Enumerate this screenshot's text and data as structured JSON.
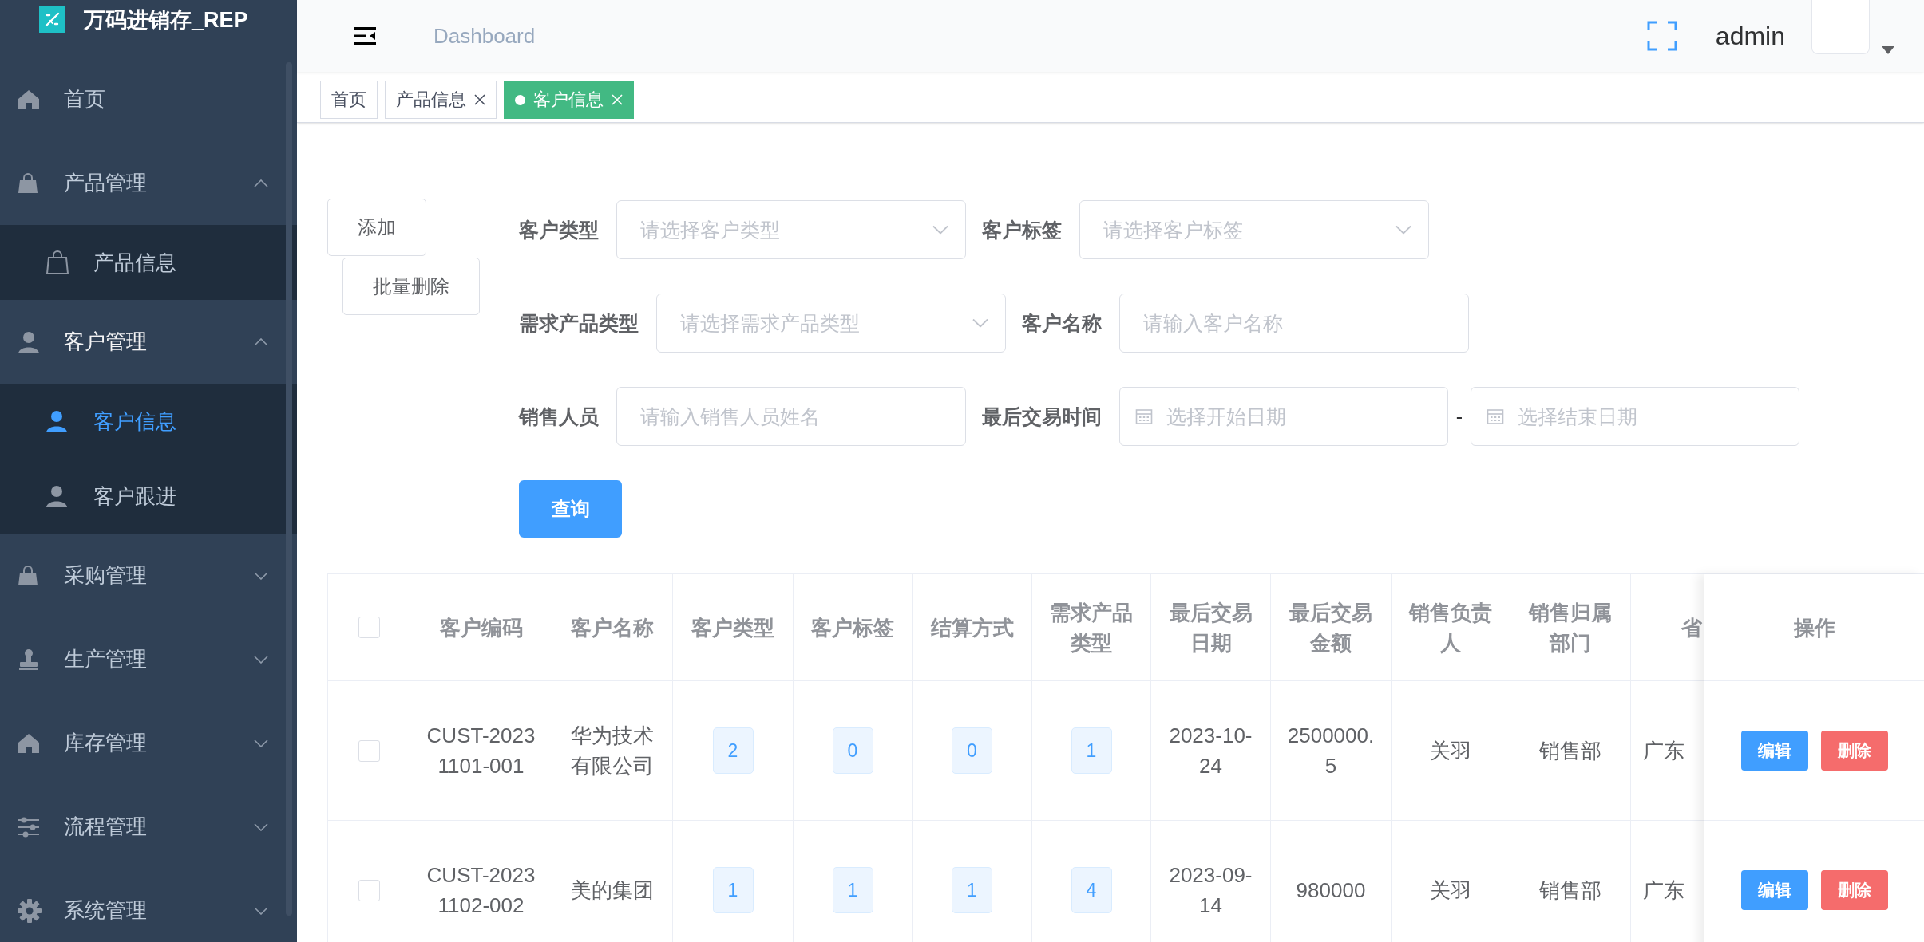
{
  "app": {
    "title": "万码进销存_REP"
  },
  "sidebar": {
    "items": [
      {
        "label": "首页",
        "selected": false
      },
      {
        "label": "产品管理",
        "selected": false,
        "expanded": true,
        "children": [
          {
            "label": "产品信息",
            "selected": false
          }
        ]
      },
      {
        "label": "客户管理",
        "selected": false,
        "expanded": true,
        "children": [
          {
            "label": "客户信息",
            "selected": true
          },
          {
            "label": "客户跟进",
            "selected": false
          }
        ]
      },
      {
        "label": "采购管理",
        "selected": false,
        "expanded": false
      },
      {
        "label": "生产管理",
        "selected": false,
        "expanded": false
      },
      {
        "label": "库存管理",
        "selected": false,
        "expanded": false
      },
      {
        "label": "流程管理",
        "selected": false,
        "expanded": false
      },
      {
        "label": "系统管理",
        "selected": false,
        "expanded": false
      }
    ]
  },
  "header": {
    "breadcrumb": "Dashboard",
    "user": "admin"
  },
  "tags": [
    {
      "label": "首页",
      "selected": false,
      "closable": false
    },
    {
      "label": "产品信息",
      "selected": false,
      "closable": true
    },
    {
      "label": "客户信息",
      "selected": true,
      "closable": true
    }
  ],
  "toolbar": {
    "buttons": [
      "添加",
      "批量删除"
    ]
  },
  "filters": {
    "rows": [
      [
        {
          "label": "客户类型",
          "kind": "select",
          "placeholder": "请选择客户类型"
        },
        {
          "label": "客户标签",
          "kind": "select",
          "placeholder": "请选择客户标签"
        }
      ],
      [
        {
          "label": "需求产品类型",
          "kind": "select",
          "placeholder": "请选择需求产品类型"
        },
        {
          "label": "客户名称",
          "kind": "input",
          "placeholder": "请输入客户名称"
        }
      ],
      [
        {
          "label": "销售人员",
          "kind": "input",
          "placeholder": "请输入销售人员姓名"
        },
        {
          "label": "最后交易时间",
          "kind": "date_range",
          "placeholder": "选择开始日期",
          "placeholder_end": "选择结束日期",
          "separator": "-"
        }
      ]
    ],
    "search_button": "查询"
  },
  "table": {
    "select_all": false,
    "columns": [
      {
        "label": "客户编码",
        "kind": "text"
      },
      {
        "label": "客户名称",
        "kind": "text"
      },
      {
        "label": "客户类型",
        "kind": "tag"
      },
      {
        "label": "客户标签",
        "kind": "tag"
      },
      {
        "label": "结算方式",
        "kind": "tag"
      },
      {
        "label": "需求产品类型",
        "kind": "tag"
      },
      {
        "label": "最后交易日期",
        "kind": "text"
      },
      {
        "label": "最后交易金额",
        "kind": "text"
      },
      {
        "label": "销售负责人",
        "kind": "text"
      },
      {
        "label": "销售归属部门",
        "kind": "text"
      },
      {
        "label": "省",
        "kind": "text"
      }
    ],
    "actions_label": "操作",
    "rows": [
      {
        "selected": false,
        "cells": [
          "CUST-20231101-001",
          "华为技术有限公司",
          "2",
          "0",
          "0",
          "1",
          "2023-10-24",
          "2500000.5",
          "关羽",
          "销售部",
          "广东"
        ],
        "actions": [
          {
            "label": "编辑",
            "kind": "edit"
          },
          {
            "label": "删除",
            "kind": "delete"
          }
        ]
      },
      {
        "selected": false,
        "cells": [
          "CUST-20231102-002",
          "美的集团",
          "1",
          "1",
          "1",
          "4",
          "2023-09-14",
          "980000",
          "关羽",
          "销售部",
          "广东"
        ],
        "actions": [
          {
            "label": "编辑",
            "kind": "edit"
          },
          {
            "label": "删除",
            "kind": "delete"
          }
        ]
      }
    ]
  }
}
